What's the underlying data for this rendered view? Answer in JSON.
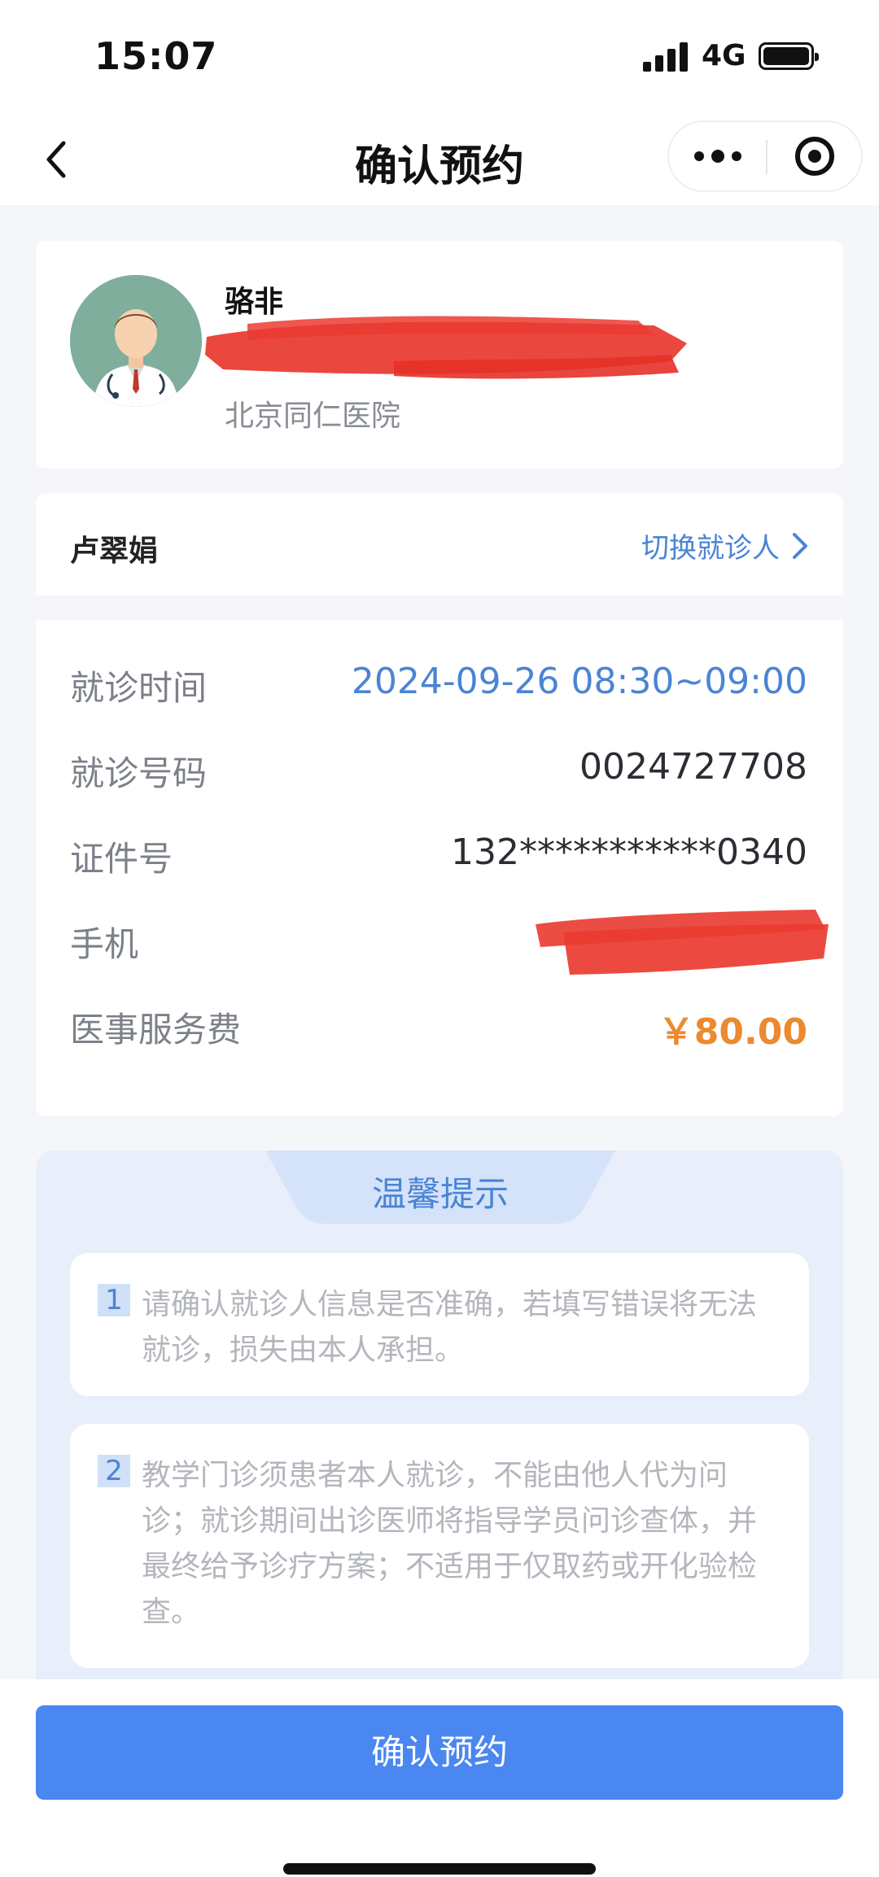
{
  "status_bar": {
    "time": "15:07",
    "network": "4G",
    "battery_level": 1.0
  },
  "nav": {
    "title": "确认预约"
  },
  "doctor": {
    "name": "骆非",
    "hospital": "北京同仁医院"
  },
  "patient": {
    "name": "卢翠娟",
    "switch_label": "切换就诊人"
  },
  "info": {
    "rows": [
      {
        "label": "就诊时间",
        "value": "2024-09-26 08:30~09:00"
      },
      {
        "label": "就诊号码",
        "value": "0024727708"
      },
      {
        "label": "证件号",
        "value": "132***********0340"
      },
      {
        "label": "手机",
        "value": ""
      },
      {
        "label": "医事服务费",
        "value": "￥80.00"
      }
    ]
  },
  "tips": {
    "title": "温馨提示",
    "items": [
      {
        "num": "1",
        "text": "请确认就诊人信息是否准确，若填写错误将无法就诊，损失由本人承担。"
      },
      {
        "num": "2",
        "text": "教学门诊须患者本人就诊，不能由他人代为问诊；就诊期间出诊医师将指导学员问诊查体，并最终给予诊疗方案；不适用于仅取药或开化验检查。"
      }
    ]
  },
  "action": {
    "confirm_label": "确认预约"
  },
  "colors": {
    "accent": "#4a84d4",
    "button": "#4a87f0",
    "price": "#ec8a2f",
    "redaction": "#e8332a"
  }
}
